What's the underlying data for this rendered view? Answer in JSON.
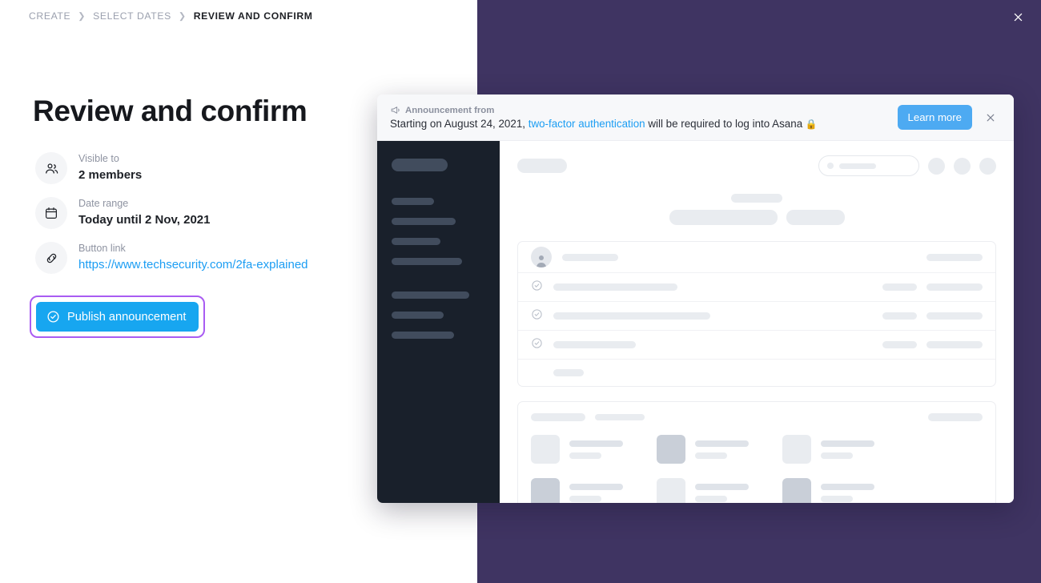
{
  "breadcrumb": {
    "items": [
      {
        "label": "CREATE",
        "current": false
      },
      {
        "label": "SELECT DATES",
        "current": false
      },
      {
        "label": "REVIEW AND CONFIRM",
        "current": true
      }
    ],
    "separator": "❯"
  },
  "page": {
    "title": "Review and confirm"
  },
  "details": [
    {
      "icon": "people-icon",
      "label": "Visible to",
      "value": "2 members",
      "is_link": false
    },
    {
      "icon": "calendar-icon",
      "label": "Date range",
      "value": "Today until 2 Nov, 2021",
      "is_link": false
    },
    {
      "icon": "link-icon",
      "label": "Button link",
      "value": "https://www.techsecurity.com/2fa-explained",
      "is_link": true
    }
  ],
  "publish": {
    "label": "Publish announcement",
    "icon": "check-circle-icon",
    "background": "#17a6f0",
    "focus_ring_color": "#a95cf2"
  },
  "preview": {
    "banner": {
      "kicker": "Announcement from",
      "kicker_icon": "megaphone-icon",
      "body_before": "Starting on August 24, 2021, ",
      "body_link": "two-factor authentication",
      "body_after": " will be required to log into Asana ",
      "emoji": "🔒",
      "learn_more_label": "Learn more",
      "learn_more_color": "#4daaf2",
      "close_icon": "close-icon"
    }
  },
  "window": {
    "close_icon": "close-icon",
    "background": "#3f3462"
  }
}
